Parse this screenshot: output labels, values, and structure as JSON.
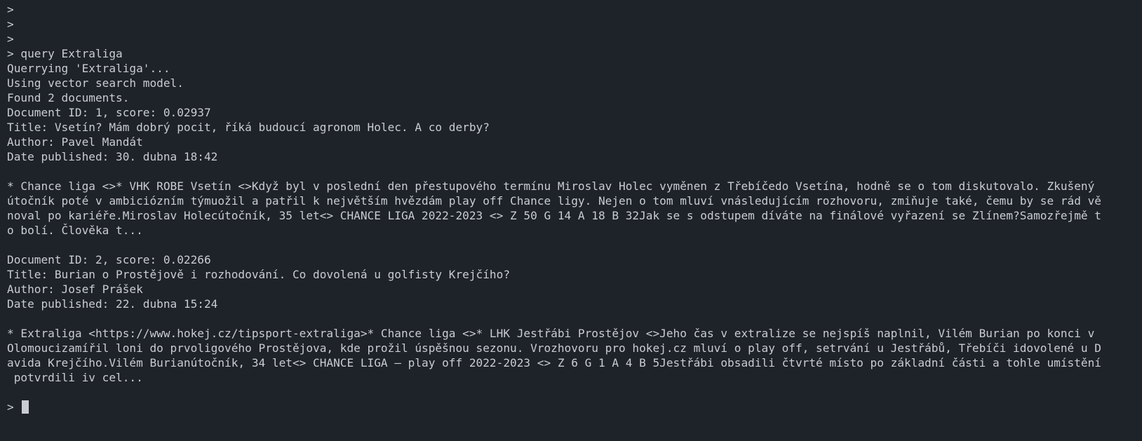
{
  "terminal": {
    "lines": [
      ">",
      ">",
      ">",
      "> query Extraliga",
      "Querrying 'Extraliga'...",
      "Using vector search model.",
      "Found 2 documents.",
      "Document ID: 1, score: 0.02937",
      "Title: Vsetín? Mám dobrý pocit, říká budoucí agronom Holec. A co derby?",
      "Author: Pavel Mandát",
      "Date published: 30. dubna 18:42",
      "",
      "* Chance liga <>* VHK ROBE Vsetín <>Když byl v poslední den přestupového termínu Miroslav Holec vyměnen z Třebíčedo Vsetína, hodně se o tom diskutovalo. Zkušený",
      "útočník poté v ambiciózním týmuožil a patřil k největším hvězdám play off Chance ligy. Nejen o tom mluví vnásledujícím rozhovoru, zmiňuje také, čemu by se rád vě",
      "noval po kariéře.Miroslav Holecútočník, 35 let<> CHANCE LIGA 2022-2023 <> Z 50 G 14 A 18 B 32Jak se s odstupem díváte na finálové vyřazení se Zlínem?Samozřejmě t",
      "o bolí. Člověka t...",
      "",
      "Document ID: 2, score: 0.02266",
      "Title: Burian o Prostějově i rozhodování. Co dovolená u golfisty Krejčího?",
      "Author: Josef Prášek",
      "Date published: 22. dubna 15:24",
      "",
      "* Extraliga <https://www.hokej.cz/tipsport-extraliga>* Chance liga <>* LHK Jestřábi Prostějov <>Jeho čas v extralize se nejspíš naplnil, Vilém Burian po konci v",
      "Olomoucizamířil loni do prvoligového Prostějova, kde prožil úspěšnou sezonu. Vrozhovoru pro hokej.cz mluví o play off, setrvání u Jestřábů, Třebíči idovolené u D",
      "avida Krejčího.Vilém Burianútočník, 34 let<> CHANCE LIGA – play off 2022-2023 <> Z 6 G 1 A 4 B 5Jestřábi obsadili čtvrté místo po základní části a tohle umístění",
      " potvrdili iv cel...",
      ""
    ],
    "prompt": "> ",
    "input_value": ""
  },
  "colors": {
    "background": "#1e2229",
    "foreground": "#c9ccd1",
    "cursor": "#c9ccd1"
  }
}
